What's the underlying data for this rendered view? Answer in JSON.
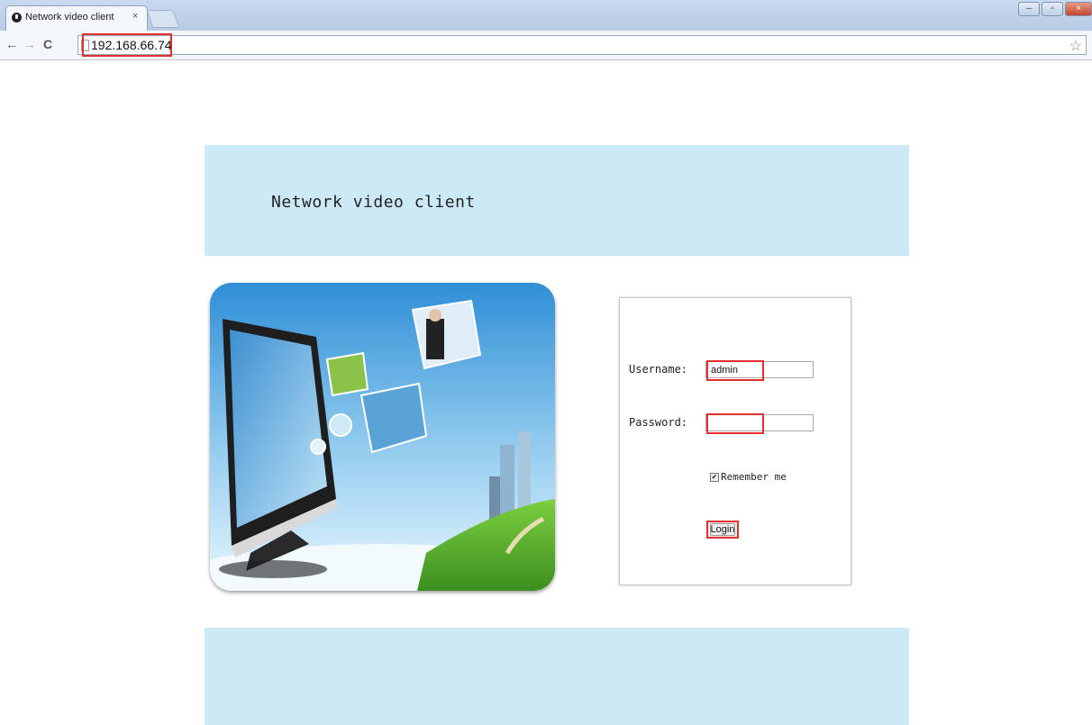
{
  "browser": {
    "tab_title": "Network video client",
    "tab_close": "×",
    "back": "←",
    "forward": "→",
    "reload": "C",
    "url": "192.168.66.74",
    "star": "☆"
  },
  "page": {
    "banner_title": "Network video client"
  },
  "login": {
    "username_label": "Username:",
    "username_value": "admin",
    "password_label": "Password:",
    "password_value": "",
    "remember_label": "Remember me",
    "remember_checked": true,
    "login_button": "Login"
  },
  "colors": {
    "banner_bg": "#cceaf6",
    "highlight": "#e03030"
  }
}
